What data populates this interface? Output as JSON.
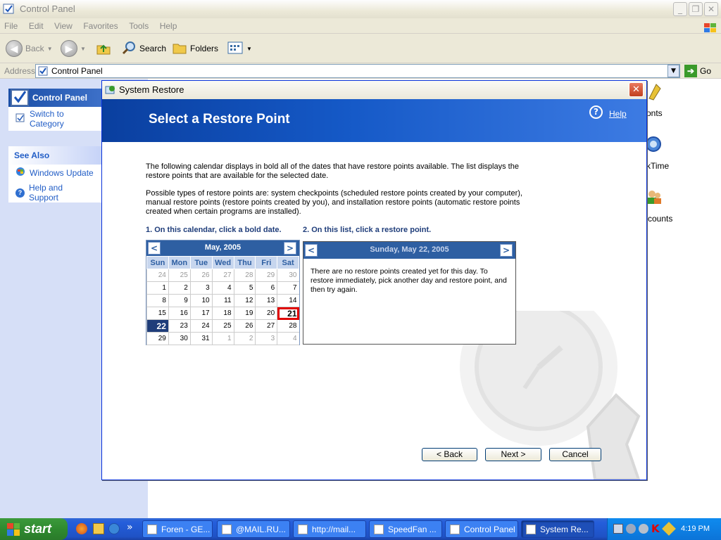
{
  "explorer": {
    "title": "Control Panel",
    "menu": [
      "File",
      "Edit",
      "View",
      "Favorites",
      "Tools",
      "Help"
    ],
    "toolbar": {
      "back": "Back",
      "search": "Search",
      "folders": "Folders"
    },
    "address_label": "Address",
    "address_value": "Control Panel",
    "go": "Go",
    "left_pane": {
      "panel_title": "Control Panel",
      "switch_link": "Switch to Category",
      "see_also": "See Also",
      "see_also_items": [
        "Windows Update",
        "Help and Support"
      ]
    },
    "right_fragments": [
      "onts",
      "kTime",
      "ccounts"
    ]
  },
  "dialog": {
    "title": "System Restore",
    "heading": "Select a Restore Point",
    "help": "Help",
    "para1": "The following calendar displays in bold all of the dates that have restore points available. The list displays the restore points that are available for the selected date.",
    "para2": "Possible types of restore points are: system checkpoints (scheduled restore points created by your computer), manual restore points (restore points created by you), and installation restore points (automatic restore points created when certain programs are installed).",
    "step1": "1. On this calendar, click a bold date.",
    "step2": "2. On this list, click a restore point.",
    "calendar": {
      "month": "May, 2005",
      "prev": "<",
      "next": ">",
      "weekdays": [
        "Sun",
        "Mon",
        "Tue",
        "Wed",
        "Thu",
        "Fri",
        "Sat"
      ],
      "weeks": [
        [
          "24",
          "25",
          "26",
          "27",
          "28",
          "29",
          "30"
        ],
        [
          "1",
          "2",
          "3",
          "4",
          "5",
          "6",
          "7"
        ],
        [
          "8",
          "9",
          "10",
          "11",
          "12",
          "13",
          "14"
        ],
        [
          "15",
          "16",
          "17",
          "18",
          "19",
          "20",
          "21"
        ],
        [
          "22",
          "23",
          "24",
          "25",
          "26",
          "27",
          "28"
        ],
        [
          "29",
          "30",
          "31",
          "1",
          "2",
          "3",
          "4"
        ]
      ],
      "selected": "22",
      "highlighted": "21"
    },
    "list": {
      "date": "Sunday, May 22, 2005",
      "prev": "<",
      "next": ">",
      "message": "There are no restore points created yet for this day. To restore immediately, pick another day and restore point, and then try again."
    },
    "buttons": {
      "back": "< Back",
      "next": "Next >",
      "cancel": "Cancel"
    }
  },
  "taskbar": {
    "start": "start",
    "more": "»",
    "tasks": [
      "Foren - GE...",
      "@MAIL.RU...",
      "http://mail...",
      "SpeedFan ...",
      "Control Panel",
      "System Re..."
    ],
    "clock": "4:19 PM"
  }
}
